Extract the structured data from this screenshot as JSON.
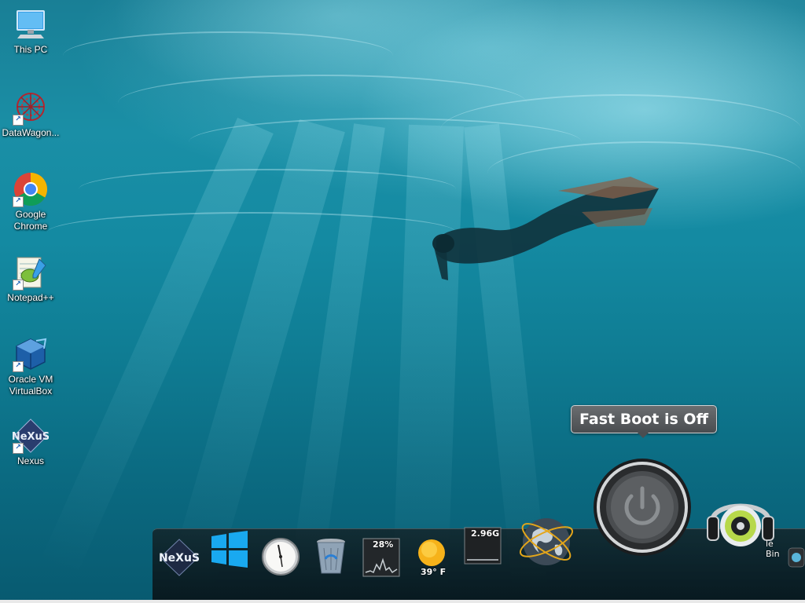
{
  "desktop_icons": [
    {
      "label": "This PC",
      "icon": "this-pc-icon"
    },
    {
      "label": "DataWagon...",
      "icon": "datawagon-icon"
    },
    {
      "label": "Google Chrome",
      "icon": "chrome-icon"
    },
    {
      "label": "Notepad++",
      "icon": "notepadpp-icon"
    },
    {
      "label": "Oracle VM VirtualBox",
      "icon": "virtualbox-icon"
    },
    {
      "label": "Nexus",
      "icon": "nexus-icon"
    }
  ],
  "tooltip": {
    "text": "Fast Boot is Off"
  },
  "dock": {
    "items": [
      {
        "name": "nexus-logo",
        "text": "NeXuS"
      },
      {
        "name": "windows-start",
        "text": ""
      },
      {
        "name": "clock",
        "text": ""
      },
      {
        "name": "recycle-bin",
        "text": ""
      },
      {
        "name": "cpu-monitor",
        "text": "28%"
      },
      {
        "name": "weather",
        "text": "39° F"
      },
      {
        "name": "memory-monitor",
        "text": "2.96G"
      },
      {
        "name": "network-globe",
        "text": ""
      },
      {
        "name": "power-button",
        "text": ""
      },
      {
        "name": "media-player",
        "text": ""
      }
    ],
    "partial_label": "le Bin"
  },
  "colors": {
    "water_top": "#197f96",
    "water_bottom": "#085a70",
    "tooltip_bg": "#55585b",
    "dock_bg": "#141e22"
  }
}
